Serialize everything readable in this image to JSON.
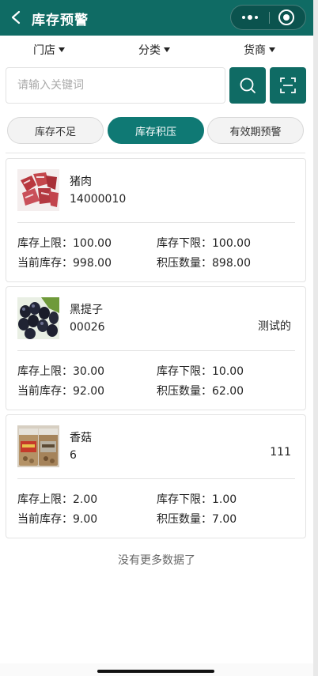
{
  "header": {
    "title": "库存预警"
  },
  "filters": [
    {
      "label": "门店"
    },
    {
      "label": "分类"
    },
    {
      "label": "货商"
    }
  ],
  "search": {
    "placeholder": "请输入关键词"
  },
  "tabs": [
    {
      "label": "库存不足",
      "active": false
    },
    {
      "label": "库存积压",
      "active": true
    },
    {
      "label": "有效期预警",
      "active": false
    }
  ],
  "labels": {
    "upper": "库存上限：",
    "lower": "库存下限：",
    "current": "当前库存：",
    "overstock": "积压数量："
  },
  "items": [
    {
      "name": "猪肉",
      "code": "14000010",
      "note": "",
      "upper": "100.00",
      "lower": "100.00",
      "current": "998.00",
      "overstock": "898.00",
      "image": "pork"
    },
    {
      "name": "黑提子",
      "code": "00026",
      "note": "测试的",
      "upper": "30.00",
      "lower": "10.00",
      "current": "92.00",
      "overstock": "62.00",
      "image": "black-grapes"
    },
    {
      "name": "香菇",
      "code": "6",
      "note": "111",
      "upper": "2.00",
      "lower": "1.00",
      "current": "9.00",
      "overstock": "7.00",
      "image": "mushroom-jars"
    }
  ],
  "footer": {
    "no_more": "没有更多数据了"
  },
  "colors": {
    "primary": "#0f6b64",
    "tab_active": "#0f7974"
  }
}
